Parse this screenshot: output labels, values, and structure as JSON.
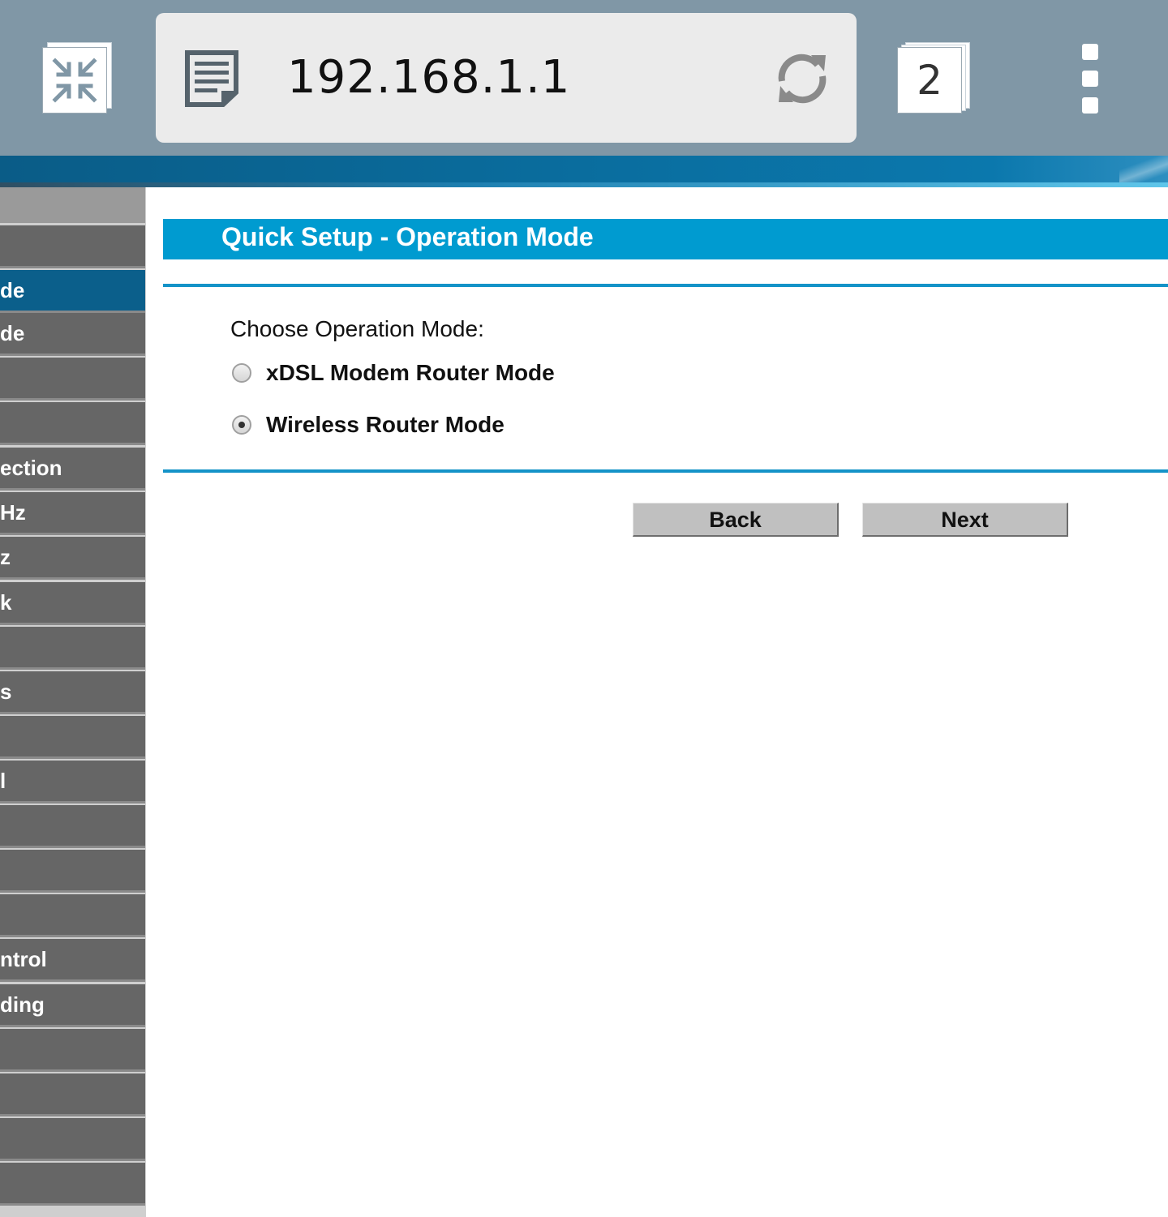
{
  "browser": {
    "url": "192.168.1.1",
    "tab_count": "2"
  },
  "sidebar": {
    "items": [
      {
        "label": ""
      },
      {
        "label": ""
      },
      {
        "label": "de"
      },
      {
        "label": ""
      },
      {
        "label": ""
      },
      {
        "label": "ection"
      },
      {
        "label": "Hz"
      },
      {
        "label": "z"
      },
      {
        "label": "k"
      },
      {
        "label": ""
      },
      {
        "label": "s"
      },
      {
        "label": ""
      },
      {
        "label": "l"
      },
      {
        "label": ""
      },
      {
        "label": ""
      },
      {
        "label": ""
      },
      {
        "label": "ntrol"
      },
      {
        "label": "ding"
      },
      {
        "label": ""
      },
      {
        "label": ""
      },
      {
        "label": ""
      },
      {
        "label": ""
      }
    ]
  },
  "main": {
    "title": "Quick Setup - Operation Mode",
    "choose_label": "Choose Operation Mode:",
    "options": [
      {
        "label": "xDSL Modem Router Mode",
        "checked": false
      },
      {
        "label": "Wireless Router Mode",
        "checked": true
      }
    ],
    "back_label": "Back",
    "next_label": "Next"
  },
  "colors": {
    "title_bar": "#009bd0",
    "sidebar_item": "#666666",
    "sidebar_active": "#0b5f8b",
    "toolbar": "#8097a6"
  }
}
